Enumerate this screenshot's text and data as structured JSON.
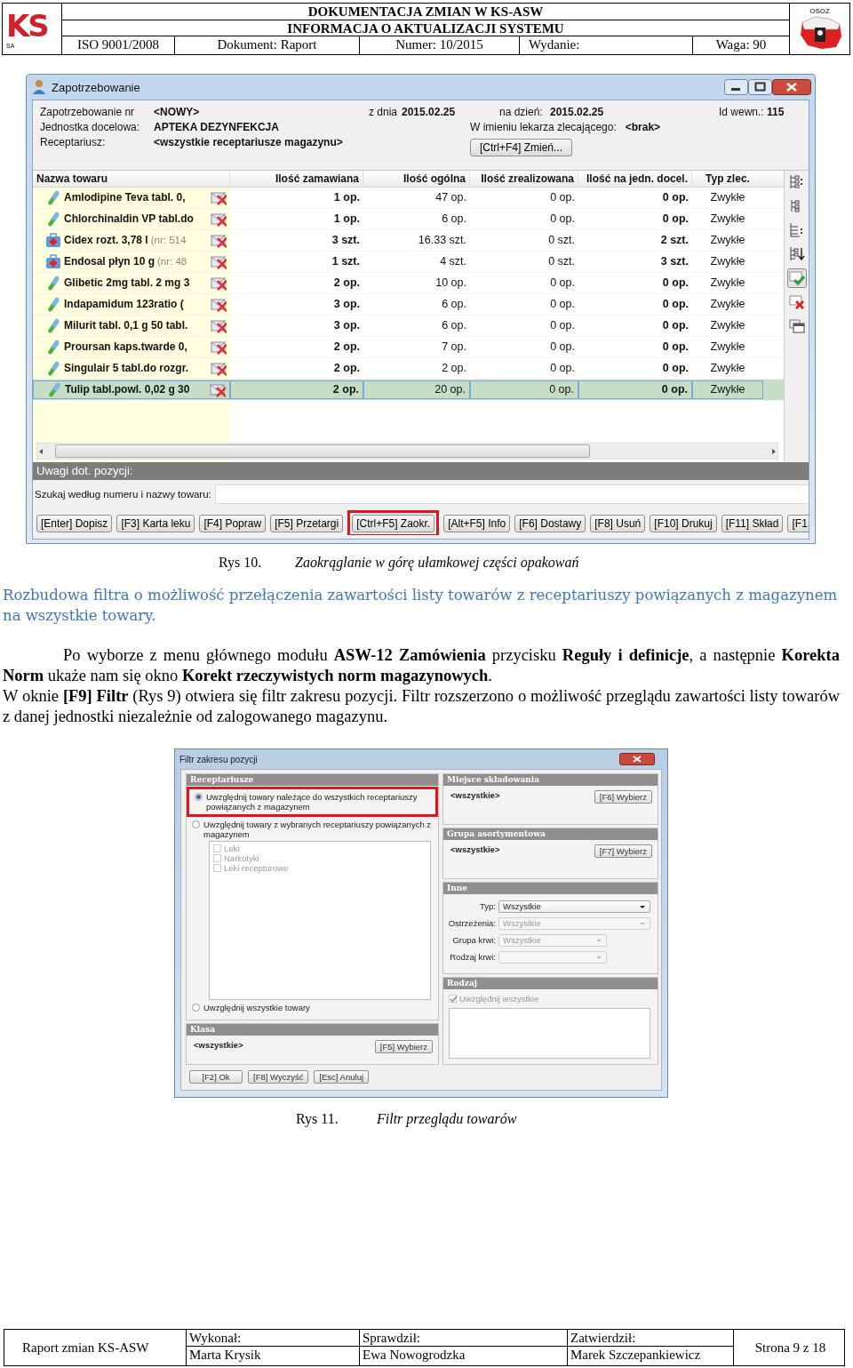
{
  "header": {
    "logo_text": "KS",
    "logo_subtext": "SA",
    "title": "DOKUMENTACJA ZMIAN W KS-ASW",
    "subtitle": "INFORMACJA O AKTUALIZACJI SYSTEMU",
    "fields": [
      "ISO 9001/2008",
      "Dokument: Raport",
      "Numer: 10/2015",
      "Wydanie:",
      "Waga: 90"
    ],
    "badge_text": "OSOZ"
  },
  "figure_1": {
    "window": {
      "title": "Zapotrzebowanie"
    },
    "info": {
      "number_label": "Zapotrzebowanie nr",
      "number": "<NOWY>",
      "unit_label": "Jednostka docelowa:",
      "unit": "APTEKA DEZYNFEKCJA",
      "pharmacy_label": "Receptariusz:",
      "pharmacy": "<wszystkie receptariusze magazynu>",
      "date_label": "z dnia",
      "date": "2015.02.25",
      "due_label": "na dzień:",
      "due": "2015.02.25",
      "doctor_label": "W imieniu lekarza zlecającego:",
      "doctor": "<brak>",
      "id_label": "Id wewn.:",
      "id": "115",
      "change_button": "[Ctrl+F4] Zmień..."
    },
    "table": {
      "name_column": "Nazwa towaru",
      "columns": [
        "Ilość zamawiana",
        "Ilość ogólna",
        "Ilość zrealizowana",
        "Ilość na jedn. docel.",
        "Typ zlec."
      ],
      "rows": [
        {
          "kind": "pill",
          "name": "Amlodipine Teva tabl. 0,",
          "cells": [
            "1 op.",
            "47 op.",
            "0 op.",
            "0 op.",
            "Zwykłe"
          ],
          "selected": false
        },
        {
          "kind": "pill",
          "name": "Chlorchinaldin VP tabl.do",
          "cells": [
            "1 op.",
            "6 op.",
            "0 op.",
            "0 op.",
            "Zwykłe"
          ],
          "selected": false
        },
        {
          "kind": "kit",
          "name": "Cidex rozt. 3,78 l",
          "note": "(nr: 514",
          "cells": [
            "3 szt.",
            "16.33 szt.",
            "0 szt.",
            "2 szt.",
            "Zwykłe"
          ],
          "selected": false
        },
        {
          "kind": "kit",
          "name": "Endosal płyn 10 g",
          "note": "(nr: 48",
          "cells": [
            "1 szt.",
            "4 szt.",
            "0 szt.",
            "3 szt.",
            "Zwykłe"
          ],
          "selected": false
        },
        {
          "kind": "pill",
          "name": "Glibetic 2mg tabl. 2 mg 3",
          "cells": [
            "2 op.",
            "10 op.",
            "0 op.",
            "0 op.",
            "Zwykłe"
          ],
          "selected": false
        },
        {
          "kind": "pill",
          "name": "Indapamidum 123ratio (",
          "cells": [
            "3 op.",
            "6 op.",
            "0 op.",
            "0 op.",
            "Zwykłe"
          ],
          "selected": false
        },
        {
          "kind": "pill",
          "name": "Milurit tabl. 0,1 g 50 tabl.",
          "cells": [
            "3 op.",
            "6 op.",
            "0 op.",
            "0 op.",
            "Zwykłe"
          ],
          "selected": false
        },
        {
          "kind": "pill",
          "name": "Proursan kaps.twarde 0,",
          "cells": [
            "2 op.",
            "7 op.",
            "0 op.",
            "0 op.",
            "Zwykłe"
          ],
          "selected": false
        },
        {
          "kind": "pill",
          "name": "Singulair 5 tabl.do rozgr.",
          "cells": [
            "2 op.",
            "2 op.",
            "0 op.",
            "0 op.",
            "Zwykłe"
          ],
          "selected": false
        },
        {
          "kind": "pill",
          "name": "Tulip tabl.powl. 0,02 g 30",
          "cells": [
            "2 op.",
            "20 op.",
            "0 op.",
            "0 op.",
            "Zwykłe"
          ],
          "selected": true
        }
      ]
    },
    "side_tools": [
      {
        "kind": "tree",
        "selected": false
      },
      {
        "kind": "tree-small",
        "selected": false
      },
      {
        "kind": "list",
        "selected": false
      },
      {
        "kind": "sort",
        "selected": false
      },
      {
        "kind": "accept",
        "selected": true
      },
      {
        "kind": "reject",
        "selected": false
      },
      {
        "kind": "windows",
        "selected": false
      }
    ],
    "remarks_label": "Uwagi dot. pozycji:",
    "search_label": "Szukaj według numeru i nazwy towaru:",
    "buttons": [
      {
        "label": "[Enter] Dopisz",
        "highlighted": false
      },
      {
        "label": "[F3] Karta leku",
        "highlighted": false
      },
      {
        "label": "[F4] Popraw",
        "highlighted": false
      },
      {
        "label": "[F5] Przetargi",
        "highlighted": false
      },
      {
        "label": "[Ctrl+F5] Zaokr.",
        "highlighted": true
      },
      {
        "label": "[Alt+F5] Info",
        "highlighted": false
      },
      {
        "label": "[F6] Dostawy",
        "highlighted": false
      },
      {
        "label": "[F8] Usuń",
        "highlighted": false
      },
      {
        "label": "[F10] Drukuj",
        "highlighted": false
      },
      {
        "label": "[F11] Skład",
        "highlighted": false
      },
      {
        "label": "[F1",
        "highlighted": false
      }
    ],
    "caption": {
      "number": "Rys 10.",
      "text": "Zaokrąglanie w górę ułamkowej części opakowań"
    }
  },
  "section_heading": "Rozbudowa filtra o możliwość przełączenia zawartości listy towarów z receptariuszy powiązanych z magazynem na wszystkie towary.",
  "paragraphs": [
    {
      "indent": true,
      "text": "Po wyborze z menu głównego modułu **ASW-12 Zamówienia** przycisku **Reguły i definicje**, a następnie **Korekta Norm** ukaże nam się okno **Korekt rzeczywistych norm magazynowych**."
    },
    {
      "indent": false,
      "text": "W oknie **[F9] Filtr** (Rys 9) otwiera się filtr zakresu pozycji. Filtr rozszerzono o możliwość przeglądu zawartości listy towarów z danej jednostki niezależnie od zalogowanego magazynu."
    }
  ],
  "figure_2": {
    "window": {
      "title": "Filtr zakresu pozycji"
    },
    "pharmacies": {
      "title": "Receptariusze",
      "radios": [
        {
          "label": "Uwzględnij towary należące do wszystkich receptariuszy powiązanych z magazynem",
          "selected": true,
          "highlighted": true
        },
        {
          "label": "Uwzględnij towary z wybranych receptariuszy powiązanych z magazynem",
          "selected": false,
          "highlighted": false
        },
        {
          "label": "Uwzględnij wszystkie towary",
          "selected": false,
          "highlighted": false
        }
      ],
      "items": [
        {
          "label": "Leki",
          "checked": false,
          "disabled": true
        },
        {
          "label": "Narkotyki",
          "checked": false,
          "disabled": true
        },
        {
          "label": "Leki recepturowe",
          "checked": false,
          "disabled": true
        }
      ]
    },
    "class": {
      "title": "Klasa",
      "value": "<wszystkie>",
      "button": "[F5] Wybierz"
    },
    "storage": {
      "title": "Miejsce składowania",
      "value": "<wszystkie>",
      "button": "[F6] Wybierz"
    },
    "group": {
      "title": "Grupa asortymentowa",
      "value": "<wszystkie>",
      "button": "[F7] Wybierz"
    },
    "other": {
      "title": "Inne",
      "fields": [
        {
          "label": "Typ:",
          "value": "Wszystkie",
          "disabled": false,
          "wide": true
        },
        {
          "label": "Ostrzeżenia:",
          "value": "Wszystkie",
          "disabled": true,
          "wide": true
        },
        {
          "label": "Grupa krwi:",
          "value": "Wszystkie",
          "disabled": true,
          "wide": false
        },
        {
          "label": "Rodzaj krwi:",
          "disabled": true,
          "wide": false
        }
      ]
    },
    "kind": {
      "title": "Rodzaj",
      "checkbox": {
        "label": "Uwzględnij wszystkie",
        "checked": true,
        "disabled": true
      }
    },
    "buttons": [
      "[F2] Ok",
      "[F8] Wyczyść",
      "[Esc] Anuluj"
    ],
    "caption": {
      "number": "Rys 11.",
      "text": "Filtr przeglądu towarów"
    }
  },
  "footer": {
    "report": "Raport zmian KS-ASW",
    "roles": [
      {
        "label": "Wykonał:",
        "name": "Marta Krysik"
      },
      {
        "label": "Sprawdził:",
        "name": "Ewa Nowogrodzka"
      },
      {
        "label": "Zatwierdził:",
        "name": "Marek Szczepankiewicz"
      }
    ],
    "page": "Strona 9 z 18"
  }
}
